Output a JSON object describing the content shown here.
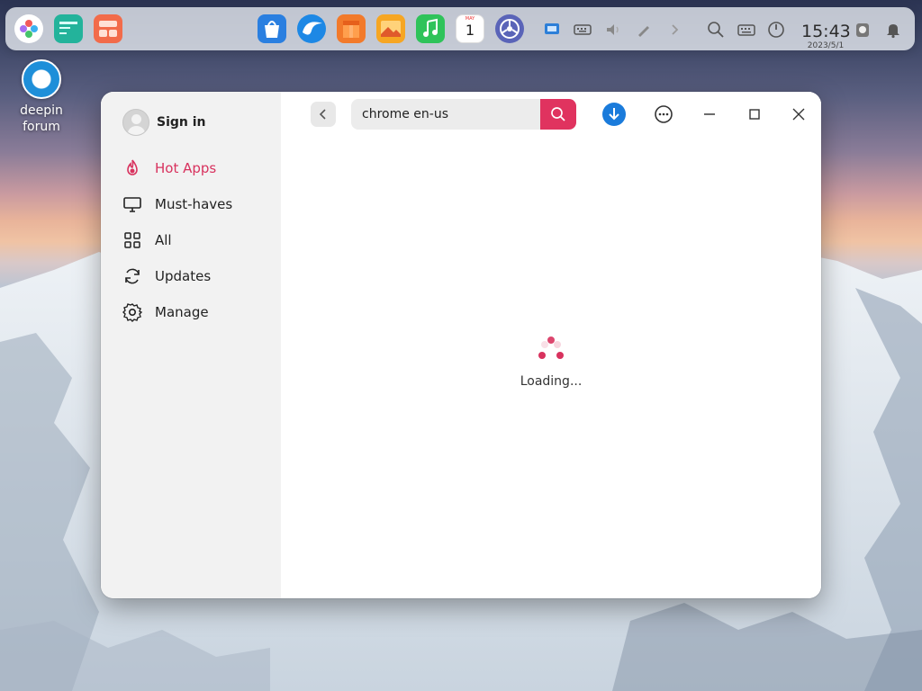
{
  "desktop": {
    "icon_label_line1": "deepin",
    "icon_label_line2": "forum"
  },
  "dock": {
    "apps": [
      "launcher-icon",
      "terminal-icon",
      "multitasking-icon",
      "app-store-icon",
      "browser-icon",
      "package-icon",
      "image-viewer-icon",
      "music-icon",
      "calendar-icon",
      "settings-icon"
    ],
    "calendar_day": "1",
    "calendar_month": "MAY",
    "tray": [
      "screenshot-icon",
      "keyboard-icon",
      "volume-icon",
      "pen-icon",
      "chevron-right-icon",
      "search-icon",
      "onscreen-keyboard-icon",
      "power-icon"
    ],
    "clock": {
      "time": "15:43",
      "date": "2023/5/1"
    }
  },
  "window": {
    "sidebar": {
      "signin_label": "Sign in",
      "items": [
        {
          "label": "Hot Apps",
          "icon": "flame-icon",
          "active": true
        },
        {
          "label": "Must-haves",
          "icon": "monitor-icon",
          "active": false
        },
        {
          "label": "All",
          "icon": "grid-icon",
          "active": false
        },
        {
          "label": "Updates",
          "icon": "refresh-icon",
          "active": false
        },
        {
          "label": "Manage",
          "icon": "gear-icon",
          "active": false
        }
      ]
    },
    "toolbar": {
      "search_value": "chrome en-us"
    },
    "content": {
      "loading_text": "Loading..."
    }
  },
  "colors": {
    "accent": "#d8325e",
    "download_blue": "#1a7bdb"
  }
}
